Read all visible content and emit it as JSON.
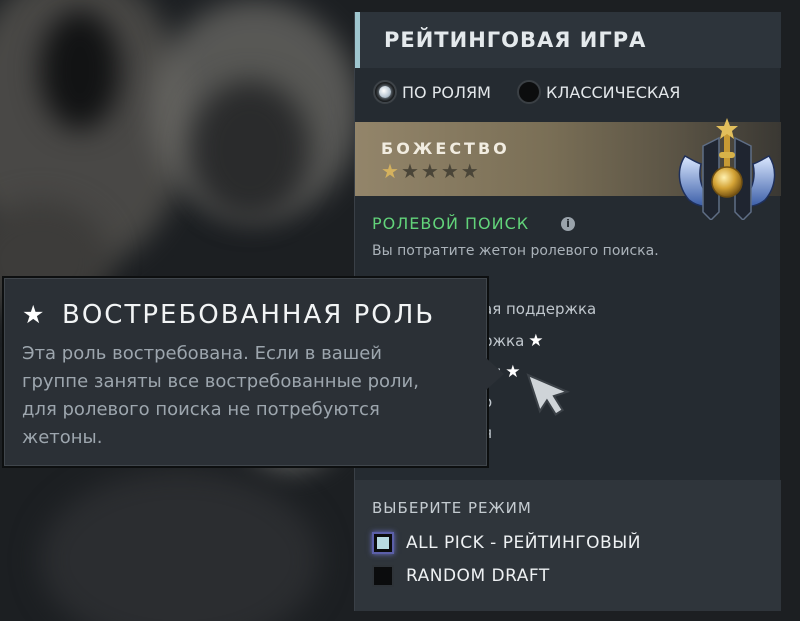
{
  "panel": {
    "title": "РЕЙТИНГОВАЯ ИГРА",
    "modes": [
      {
        "label": "ПО РОЛЯМ",
        "selected": true
      },
      {
        "label": "КЛАССИЧЕСКАЯ",
        "selected": false
      }
    ],
    "rank": {
      "name": "БОЖЕСТВО",
      "stars_total": 5,
      "stars_filled": 1
    },
    "role_search": {
      "title": "РОЛЕВОЙ ПОИСК",
      "info_icon": "i",
      "description": "Вы потратите жетон ролевого поиска."
    },
    "roles_visible": [
      {
        "text": "ая поддержка",
        "in_demand": false
      },
      {
        "text": "ржка",
        "in_demand": true
      },
      {
        "text": "ая",
        "in_demand": true
      },
      {
        "text": "о",
        "in_demand": false
      },
      {
        "text": "я",
        "in_demand": false
      }
    ],
    "choose_mode": {
      "label": "ВЫБЕРИТЕ РЕЖИМ",
      "options": [
        {
          "label": "ALL PICK - РЕЙТИНГОВЫЙ",
          "checked": true
        },
        {
          "label": "RANDOM DRAFT",
          "checked": false
        }
      ]
    }
  },
  "tooltip": {
    "title": "ВОСТРЕБОВАННАЯ РОЛЬ",
    "lines": [
      "Эта роль востребована. Если в вашей",
      "группе заняты все востребованные роли,",
      "для ролевого поиска не потребуются",
      "жетоны."
    ]
  },
  "icons": {
    "star": "★",
    "tooltip_icon": "star-icon",
    "rank_medal": "divine-rank-medal-icon",
    "cursor": "mouse-cursor-icon"
  },
  "colors": {
    "accent": "#9fc6cf",
    "role_search_green": "#62d37a",
    "rank_gold": "#d4b15e"
  }
}
